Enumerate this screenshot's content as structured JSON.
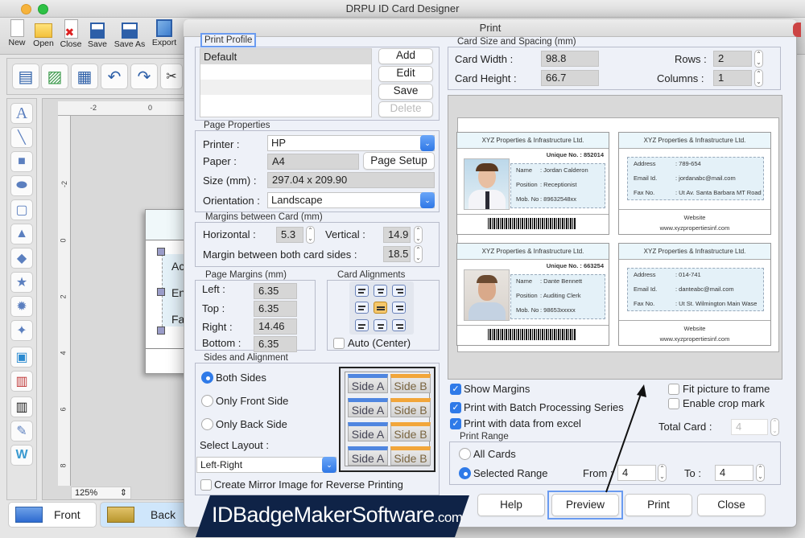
{
  "app": {
    "title": "DRPU ID Card Designer",
    "toolbar": [
      {
        "label": "New",
        "icon": "new-document-icon"
      },
      {
        "label": "Open",
        "icon": "open-folder-icon"
      },
      {
        "label": "Close",
        "icon": "close-document-icon"
      },
      {
        "label": "Save",
        "icon": "save-icon"
      },
      {
        "label": "Save As",
        "icon": "save-as-icon"
      },
      {
        "label": "Export",
        "icon": "export-icon"
      }
    ],
    "secondary_toolbar": [
      "document-properties-icon",
      "image-icon",
      "export-image-icon",
      "undo-icon",
      "redo-icon",
      "cut-icon"
    ],
    "left_tools": [
      "text-tool-icon",
      "line-tool-icon",
      "rectangle-tool-icon",
      "ellipse-tool-icon",
      "rounded-rectangle-tool-icon",
      "triangle-tool-icon",
      "diamond-tool-icon",
      "star-tool-icon",
      "burst-tool-icon",
      "four-point-star-tool-icon",
      "picture-tool-icon",
      "library-tool-icon",
      "barcode-tool-icon",
      "signature-tool-icon",
      "watermark-tool-icon"
    ],
    "ruler_top_ticks": [
      "-2",
      "0"
    ],
    "ruler_left_ticks": [
      "-2",
      "0",
      "2",
      "4",
      "6",
      "8"
    ],
    "canvas_card_text": [
      "Ac",
      "En",
      "Fa"
    ],
    "zoom_level": "125%",
    "bottom_tabs": {
      "front": "Front",
      "back": "Back"
    },
    "watermark_text": "IDBadgeMakerSoftware",
    "watermark_suffix": ".com"
  },
  "dialog": {
    "title": "Print",
    "print_profile": {
      "title": "Print Profile",
      "items": [
        "Default",
        "",
        "",
        "",
        ""
      ],
      "buttons": {
        "add": "Add",
        "edit": "Edit",
        "save": "Save",
        "delete": "Delete"
      }
    },
    "page_properties": {
      "title": "Page Properties",
      "printer_label": "Printer :",
      "printer_value": "HP",
      "paper_label": "Paper :",
      "paper_value": "A4",
      "page_setup_label": "Page Setup",
      "size_label": "Size (mm) :",
      "size_value": "297.04 x 209.90",
      "orientation_label": "Orientation :",
      "orientation_value": "Landscape"
    },
    "margins_between_card": {
      "title": "Margins between Card (mm)",
      "horizontal_label": "Horizontal :",
      "horizontal_value": "5.3",
      "vertical_label": "Vertical :",
      "vertical_value": "14.9",
      "both_sides_label": "Margin between both card sides :",
      "both_sides_value": "18.5"
    },
    "page_margins": {
      "title": "Page Margins (mm)",
      "left_label": "Left :",
      "left_value": "6.35",
      "top_label": "Top :",
      "top_value": "6.35",
      "right_label": "Right :",
      "right_value": "14.46",
      "bottom_label": "Bottom :",
      "bottom_value": "6.35"
    },
    "card_alignments": {
      "title": "Card Alignments",
      "selected": "middle-center",
      "auto_center_label": "Auto (Center)",
      "auto_center_checked": false
    },
    "sides_alignment": {
      "title": "Sides and Alignment",
      "options": [
        "Both Sides",
        "Only Front Side",
        "Only Back Side"
      ],
      "selected": "Both Sides",
      "select_layout_label": "Select Layout :",
      "layout_value": "Left-Right",
      "side_a_label": "Side A",
      "side_b_label": "Side B",
      "mirror_label": "Create Mirror Image for Reverse Printing",
      "mirror_checked": false
    },
    "card_size": {
      "title": "Card Size and Spacing (mm)",
      "width_label": "Card Width :",
      "width_value": "98.8",
      "height_label": "Card Height :",
      "height_value": "66.7",
      "rows_label": "Rows :",
      "rows_value": "2",
      "columns_label": "Columns :",
      "columns_value": "1"
    },
    "preview_cards": [
      {
        "company": "XYZ Properties & Infrastructure Ltd.",
        "unique": "Unique No. : 852014",
        "name_label": "Name",
        "name": ": Jordan Calderon",
        "position_label": "Position",
        "position": ": Receptionist",
        "mob_label": "Mob. No",
        "mob": ": 89632548xx"
      },
      {
        "company": "XYZ Properties & Infrastructure Ltd.",
        "address_label": "Address",
        "address": ": 789-654",
        "email_label": "Email Id.",
        "email": ": jordanabc@mail.com",
        "fax_label": "Fax No.",
        "fax": ": Ut Av. Santa Barbara MT Road",
        "website_label": "Website",
        "website": "www.xyzpropertiesinf.com"
      },
      {
        "company": "XYZ Properties & Infrastructure Ltd.",
        "unique": "Unique No. : 663254",
        "name_label": "Name",
        "name": ": Dante Bennett",
        "position_label": "Position",
        "position": ": Auditing Clerk",
        "mob_label": "Mob. No",
        "mob": ": 98653xxxxx"
      },
      {
        "company": "XYZ Properties & Infrastructure Ltd.",
        "address_label": "Address",
        "address": ": 014-741",
        "email_label": "Email Id.",
        "email": ": danteabc@mail.com",
        "fax_label": "Fax No.",
        "fax": ": Ut St. Wilmington Main Wase",
        "website_label": "Website",
        "website": "www.xyzpropertiesinf.com"
      }
    ],
    "options": {
      "show_margins": {
        "label": "Show Margins",
        "checked": true
      },
      "batch_processing": {
        "label": "Print with Batch Processing Series",
        "checked": true
      },
      "data_from_excel": {
        "label": "Print with data from excel",
        "checked": true
      },
      "fit_picture": {
        "label": "Fit picture to frame",
        "checked": false
      },
      "crop_mark": {
        "label": "Enable crop mark",
        "checked": false
      },
      "total_card_label": "Total Card :",
      "total_card_value": "4"
    },
    "print_range": {
      "title": "Print Range",
      "all_label": "All Cards",
      "selected_label": "Selected Range",
      "selected": "Selected Range",
      "from_label": "From :",
      "from_value": "4",
      "to_label": "To :",
      "to_value": "4"
    },
    "buttons": {
      "help": "Help",
      "preview": "Preview",
      "print": "Print",
      "close": "Close"
    }
  }
}
